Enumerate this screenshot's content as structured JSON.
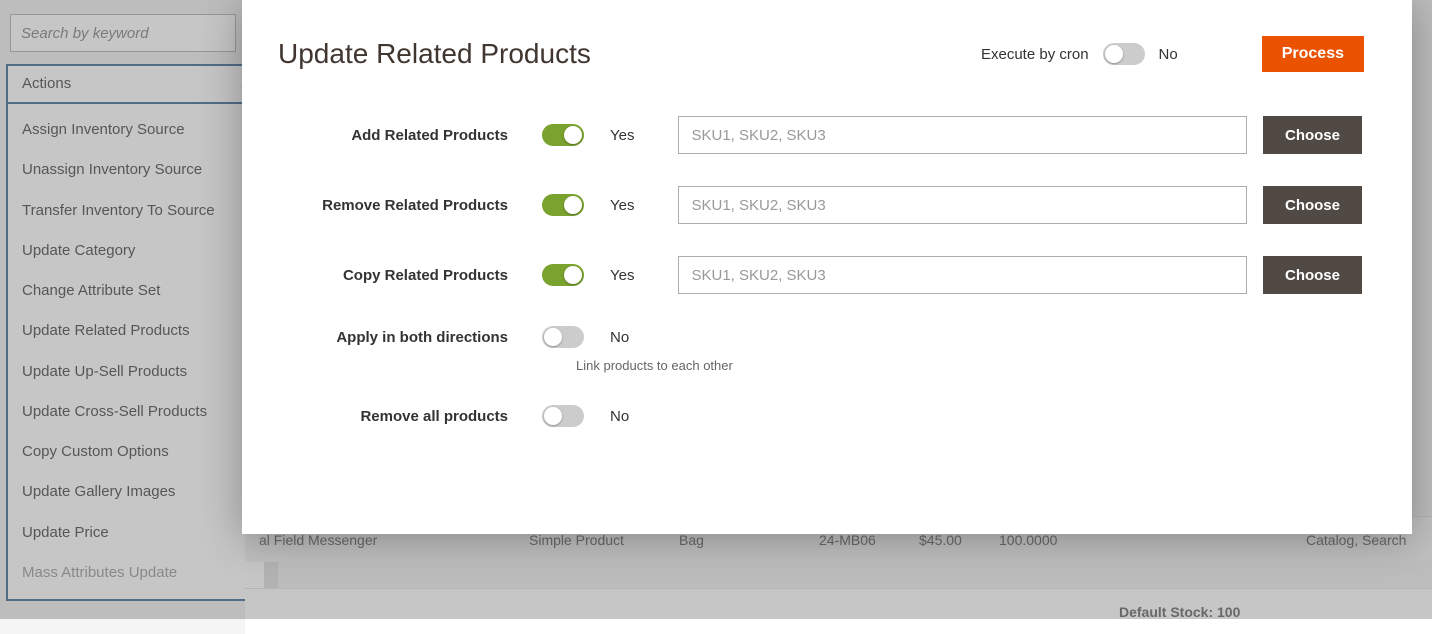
{
  "search": {
    "placeholder": "Search by keyword"
  },
  "actions": {
    "header": "Actions",
    "items": [
      "Assign Inventory Source",
      "Unassign Inventory Source",
      "Transfer Inventory To Source",
      "Update Category",
      "Change Attribute Set",
      "Update Related Products",
      "Update Up-Sell Products",
      "Update Cross-Sell Products",
      "Copy Custom Options",
      "Update Gallery Images",
      "Update Price",
      "Mass Attributes Update"
    ]
  },
  "modal": {
    "title": "Update Related Products",
    "cron_label": "Execute by cron",
    "cron_state": "No",
    "process": "Process",
    "rows": {
      "add": {
        "label": "Add Related Products",
        "state": "Yes",
        "placeholder": "SKU1, SKU2, SKU3",
        "choose": "Choose"
      },
      "remove": {
        "label": "Remove Related Products",
        "state": "Yes",
        "placeholder": "SKU1, SKU2, SKU3",
        "choose": "Choose"
      },
      "copy": {
        "label": "Copy Related Products",
        "state": "Yes",
        "placeholder": "SKU1, SKU2, SKU3",
        "choose": "Choose"
      },
      "both": {
        "label": "Apply in both directions",
        "state": "No",
        "helper": "Link products to each other"
      },
      "removeAll": {
        "label": "Remove all products",
        "state": "No"
      }
    }
  },
  "grid": {
    "row1": {
      "name": "al Field Messenger",
      "type": "Simple Product",
      "attrset": "Bag",
      "sku": "24-MB06",
      "price": "$45.00",
      "qty": "100.0000",
      "visibility": "Catalog, Search"
    },
    "row2": {
      "stock": "Default Stock: 100"
    }
  }
}
